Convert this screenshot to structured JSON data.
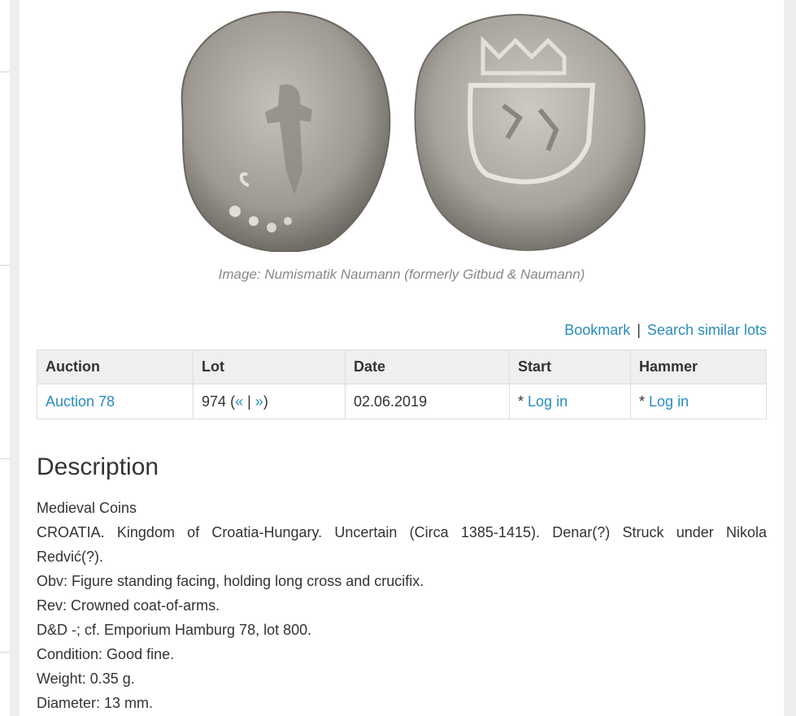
{
  "image": {
    "caption": "Image: Numismatik Naumann (formerly Gitbud & Naumann)",
    "coins": [
      {
        "name": "obverse",
        "color": "#9a9690"
      },
      {
        "name": "reverse",
        "color": "#a9a6a0"
      }
    ]
  },
  "actions": {
    "bookmark": "Bookmark",
    "separator": "|",
    "search_similar": "Search similar lots"
  },
  "table": {
    "headers": [
      "Auction",
      "Lot",
      "Date",
      "Start",
      "Hammer"
    ],
    "row": {
      "auction": "Auction 78",
      "lot_number": "974",
      "lot_open": "(",
      "prev": "«",
      "pipe": "|",
      "next": "»",
      "lot_close": ")",
      "date": "02.06.2019",
      "start_prefix": "*",
      "start_link": "Log in",
      "hammer_prefix": "*",
      "hammer_link": "Log in"
    }
  },
  "description": {
    "title": "Description",
    "lines": [
      "Medieval Coins",
      "CROATIA. Kingdom of Croatia-Hungary. Uncertain (Circa 1385-1415). Denar(?) Struck under Nikola",
      "Redvić(?).",
      "Obv: Figure standing facing, holding long cross and crucifix.",
      "Rev: Crowned coat-of-arms.",
      "D&D -; cf. Emporium Hamburg 78, lot 800.",
      "Condition: Good fine.",
      "Weight: 0.35 g.",
      "Diameter: 13 mm."
    ]
  },
  "colors": {
    "link": "#2a8bbf",
    "header_bg": "#efefef",
    "page_bg": "#eeeeee"
  }
}
